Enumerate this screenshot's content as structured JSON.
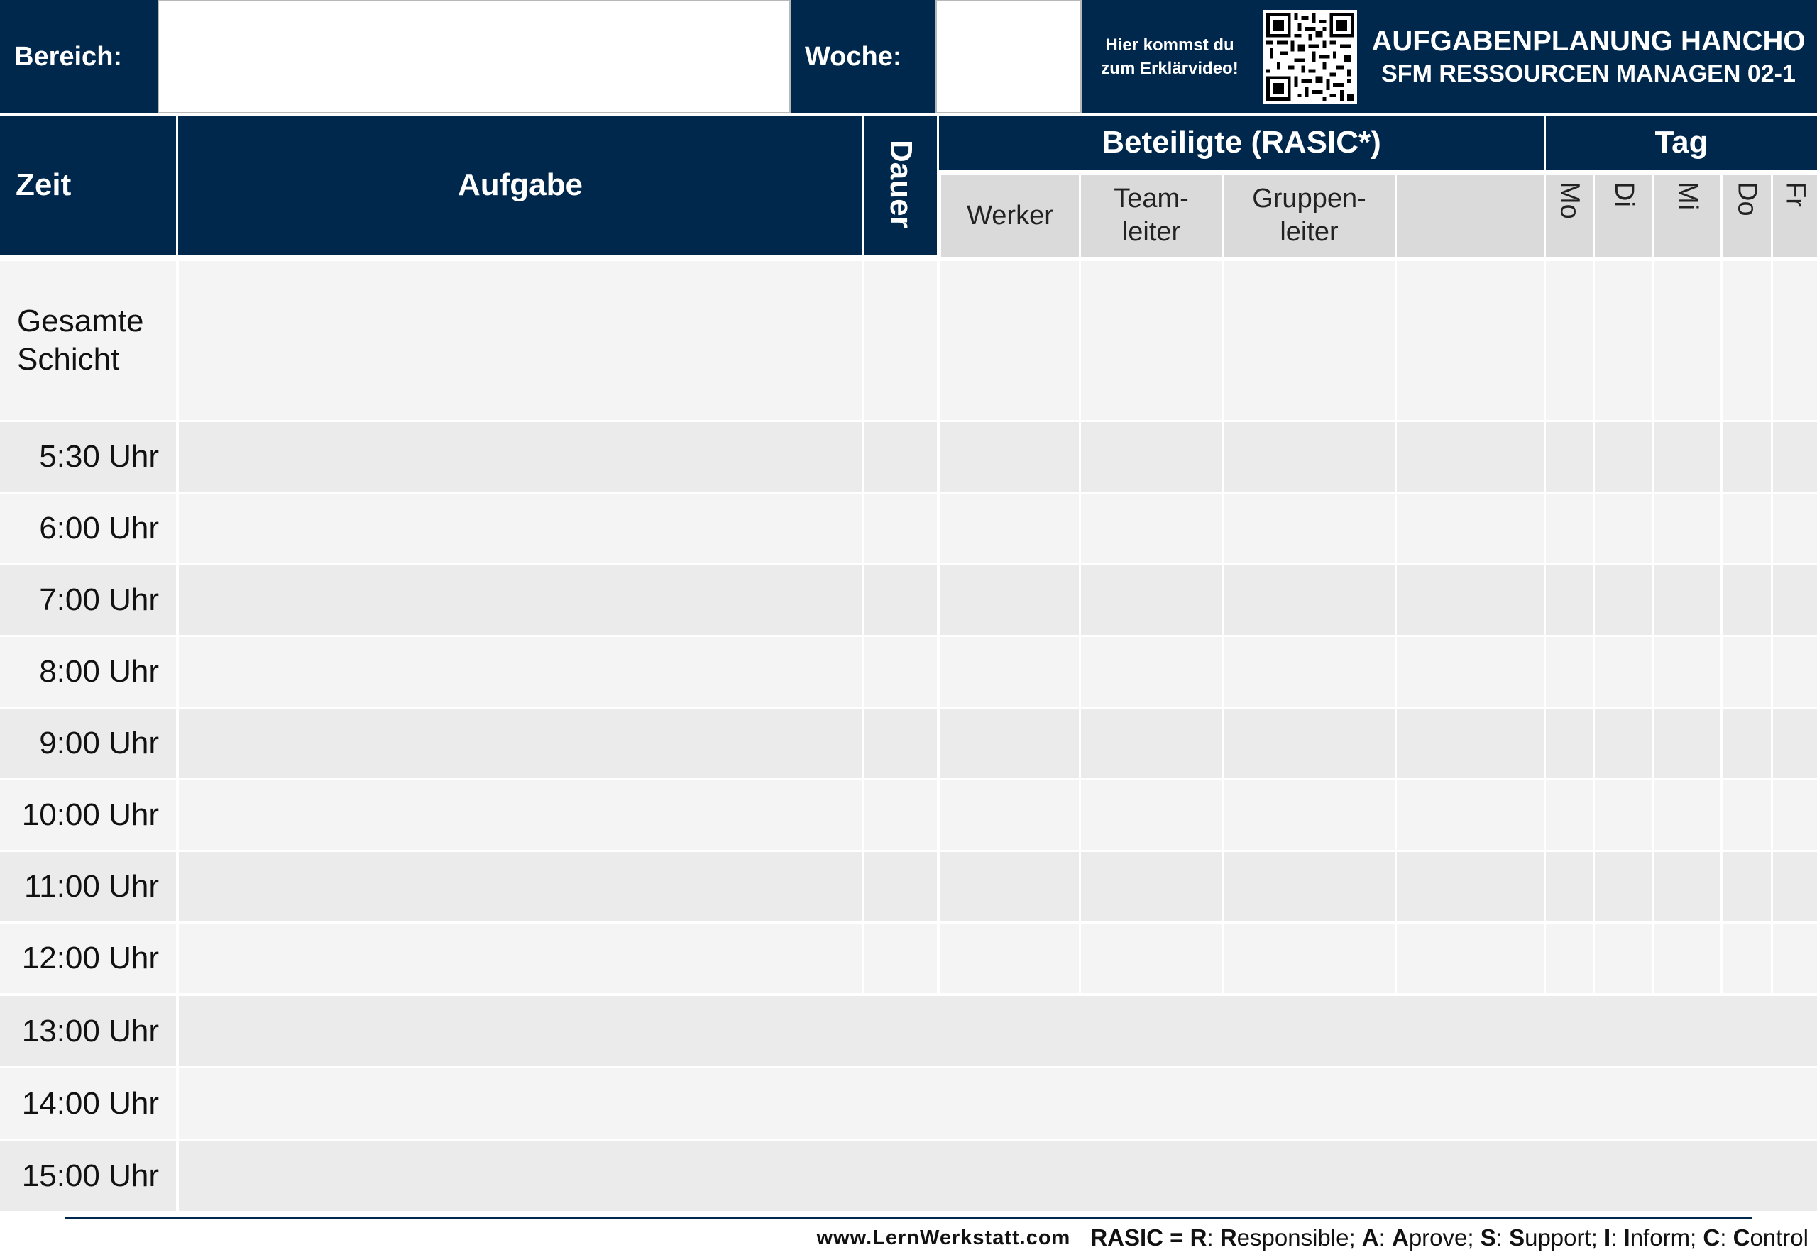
{
  "header": {
    "bereich_label": "Bereich:",
    "woche_label": "Woche:",
    "qr_text_line1": "Hier kommst du",
    "qr_text_line2": "zum Erklärvideo!",
    "title_line1": "AUFGABENPLANUNG HANCHO",
    "title_line2": "SFM RESSOURCEN MANAGEN 02-1"
  },
  "table": {
    "col_zeit": "Zeit",
    "col_aufgabe": "Aufgabe",
    "col_dauer": "Dauer",
    "beteiligte_header": "Beteiligte (RASIC*)",
    "tag_header": "Tag",
    "beteiligte": [
      {
        "line1": "Werker",
        "line2": ""
      },
      {
        "line1": "Team-",
        "line2": "leiter"
      },
      {
        "line1": "Gruppen-",
        "line2": "leiter"
      },
      {
        "line1": "",
        "line2": ""
      }
    ],
    "days": [
      "Mo",
      "Di",
      "Mi",
      "Do",
      "Fr"
    ],
    "first_row": {
      "line1": "Gesamte",
      "line2": "Schicht"
    },
    "times": [
      "5:30 Uhr",
      "6:00 Uhr",
      "7:00 Uhr",
      "8:00 Uhr",
      "9:00 Uhr",
      "10:00 Uhr",
      "11:00 Uhr",
      "12:00 Uhr",
      "13:00 Uhr",
      "14:00 Uhr",
      "15:00 Uhr"
    ]
  },
  "footer": {
    "website": "www.LernWerkstatt.com",
    "rasic_prefix": "RASIC = ",
    "legend": [
      {
        "key": "R",
        "sep": ": ",
        "initial": "R",
        "rest": "esponsible; "
      },
      {
        "key": "A",
        "sep": ": ",
        "initial": "A",
        "rest": "prove; "
      },
      {
        "key": "S",
        "sep": ": ",
        "initial": "S",
        "rest": "upport; "
      },
      {
        "key": "I",
        "sep": ": ",
        "initial": "I",
        "rest": "nform; "
      },
      {
        "key": "C",
        "sep": ": ",
        "initial": "C",
        "rest": "ontrol"
      }
    ]
  },
  "colors": {
    "navy": "#00274c",
    "row_light": "#f4f4f4",
    "row_dark": "#ebebeb",
    "subheader": "#dadada"
  }
}
